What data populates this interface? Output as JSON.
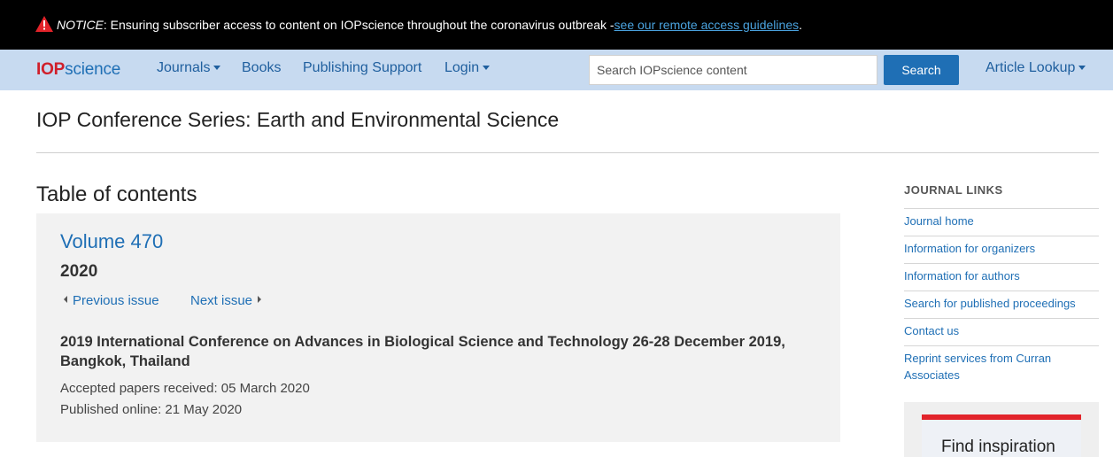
{
  "notice": {
    "label": "NOTICE",
    "message": ": Ensuring subscriber access to content on IOPscience throughout the coronavirus outbreak - ",
    "link": "see our remote access guidelines",
    "trailing": "."
  },
  "nav": {
    "logo_iop": "IOP",
    "logo_science": "science",
    "journals": "Journals",
    "books": "Books",
    "publishing_support": "Publishing Support",
    "login": "Login",
    "search_placeholder": "Search IOPscience content",
    "search_button": "Search",
    "article_lookup": "Article Lookup"
  },
  "journal_title": "IOP Conference Series: Earth and Environmental Science",
  "main": {
    "heading": "Table of contents",
    "volume": "Volume 470",
    "year": "2020",
    "previous_issue": "Previous issue",
    "next_issue": "Next issue",
    "conference_title": "2019 International Conference on Advances in Biological Science and Technology 26-28 December 2019, Bangkok, Thailand",
    "accepted": "Accepted papers received: 05 March 2020",
    "published": "Published online: 21 May 2020"
  },
  "sidebar": {
    "heading": "JOURNAL LINKS",
    "links": [
      "Journal home",
      "Information for organizers",
      "Information for authors",
      "Search for published proceedings",
      "Contact us",
      "Reprint services from Curran Associates"
    ],
    "promo_text": "Find inspiration"
  },
  "colors": {
    "notice_bg": "#000000",
    "nav_bg": "#c7daf0",
    "link": "#1f6fb5",
    "brand_red": "#d01f2a"
  }
}
